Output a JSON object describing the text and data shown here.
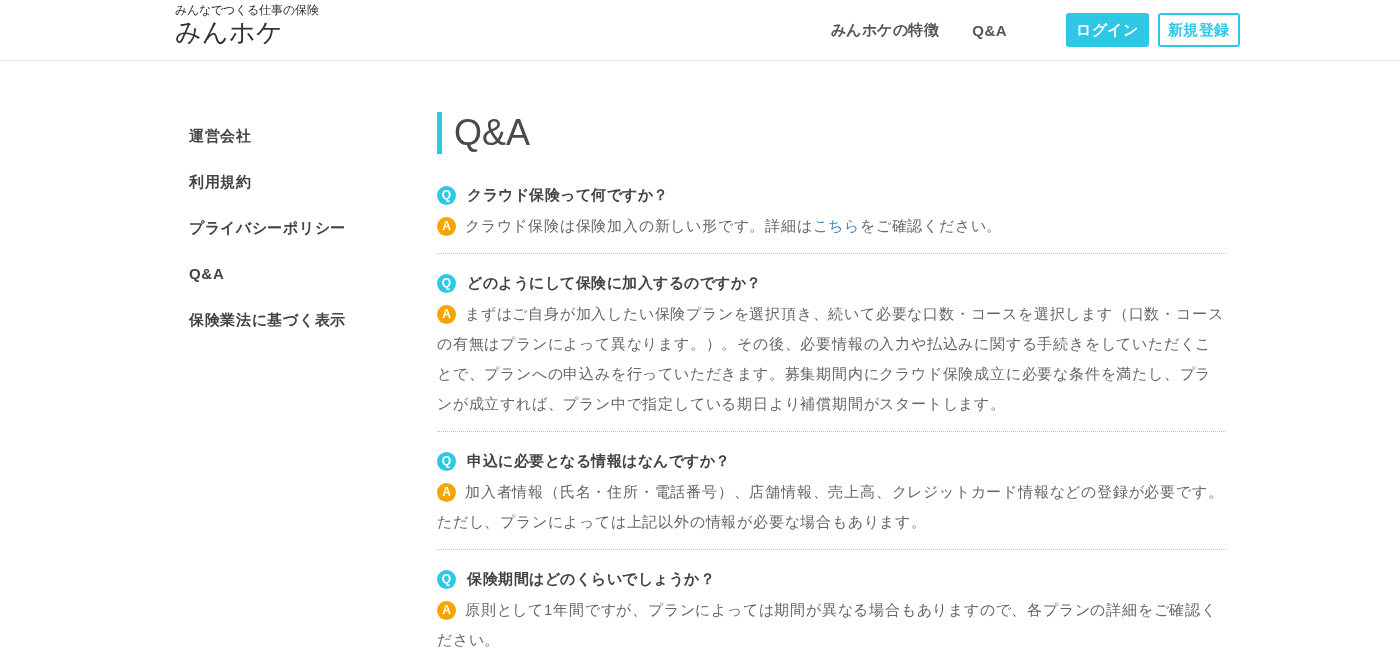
{
  "header": {
    "logo": {
      "tagline": "みんなでつくる仕事の保険",
      "name": "みんホケ"
    },
    "nav": [
      "みんホケの特徴",
      "Q&A"
    ],
    "buttons": [
      {
        "label": "ログイン",
        "kind": "primary"
      },
      {
        "label": "新規登録",
        "kind": "outline"
      }
    ]
  },
  "sidebar": {
    "items": [
      "運営会社",
      "利用規約",
      "プライバシーポリシー",
      "Q&A",
      "保険業法に基づく表示"
    ]
  },
  "main": {
    "title": "Q&A",
    "qa": [
      {
        "question": {
          "marker": "Q",
          "text": "クラウド保険って何ですか？"
        },
        "answer": {
          "marker": "A",
          "segments": [
            {
              "kind": "text",
              "text": "クラウド保険は保険加入の新しい形です。詳細は"
            },
            {
              "kind": "link",
              "text": "こちら"
            },
            {
              "kind": "text",
              "text": "をご確認ください。"
            }
          ]
        }
      },
      {
        "question": {
          "marker": "Q",
          "text": "どのようにして保険に加入するのですか？"
        },
        "answer": {
          "marker": "A",
          "segments": [
            {
              "kind": "text",
              "text": "まずはご自身が加入したい保険プランを選択頂き、続いて必要な口数・コースを選択します（口数・コースの有無はプランによって異なります。）。その後、必要情報の入力や払込みに関する手続きをしていただくことで、プランへの申込みを行っていただきます。募集期間内にクラウド保険成立に必要な条件を満たし、プランが成立すれば、プラン中で指定している期日より補償期間がスタートします。"
            }
          ]
        }
      },
      {
        "question": {
          "marker": "Q",
          "text": "申込に必要となる情報はなんですか？"
        },
        "answer": {
          "marker": "A",
          "segments": [
            {
              "kind": "text",
              "text": "加入者情報（氏名・住所・電話番号）、店舗情報、売上高、クレジットカード情報などの登録が必要です。ただし、プランによっては上記以外の情報が必要な場合もあります。"
            }
          ]
        }
      },
      {
        "question": {
          "marker": "Q",
          "text": "保険期間はどのくらいでしょうか？"
        },
        "answer": {
          "marker": "A",
          "segments": [
            {
              "kind": "text",
              "text": "原則として1年間ですが、プランによっては期間が異なる場合もありますので、各プランの詳細をご確認ください。"
            }
          ]
        }
      }
    ]
  }
}
